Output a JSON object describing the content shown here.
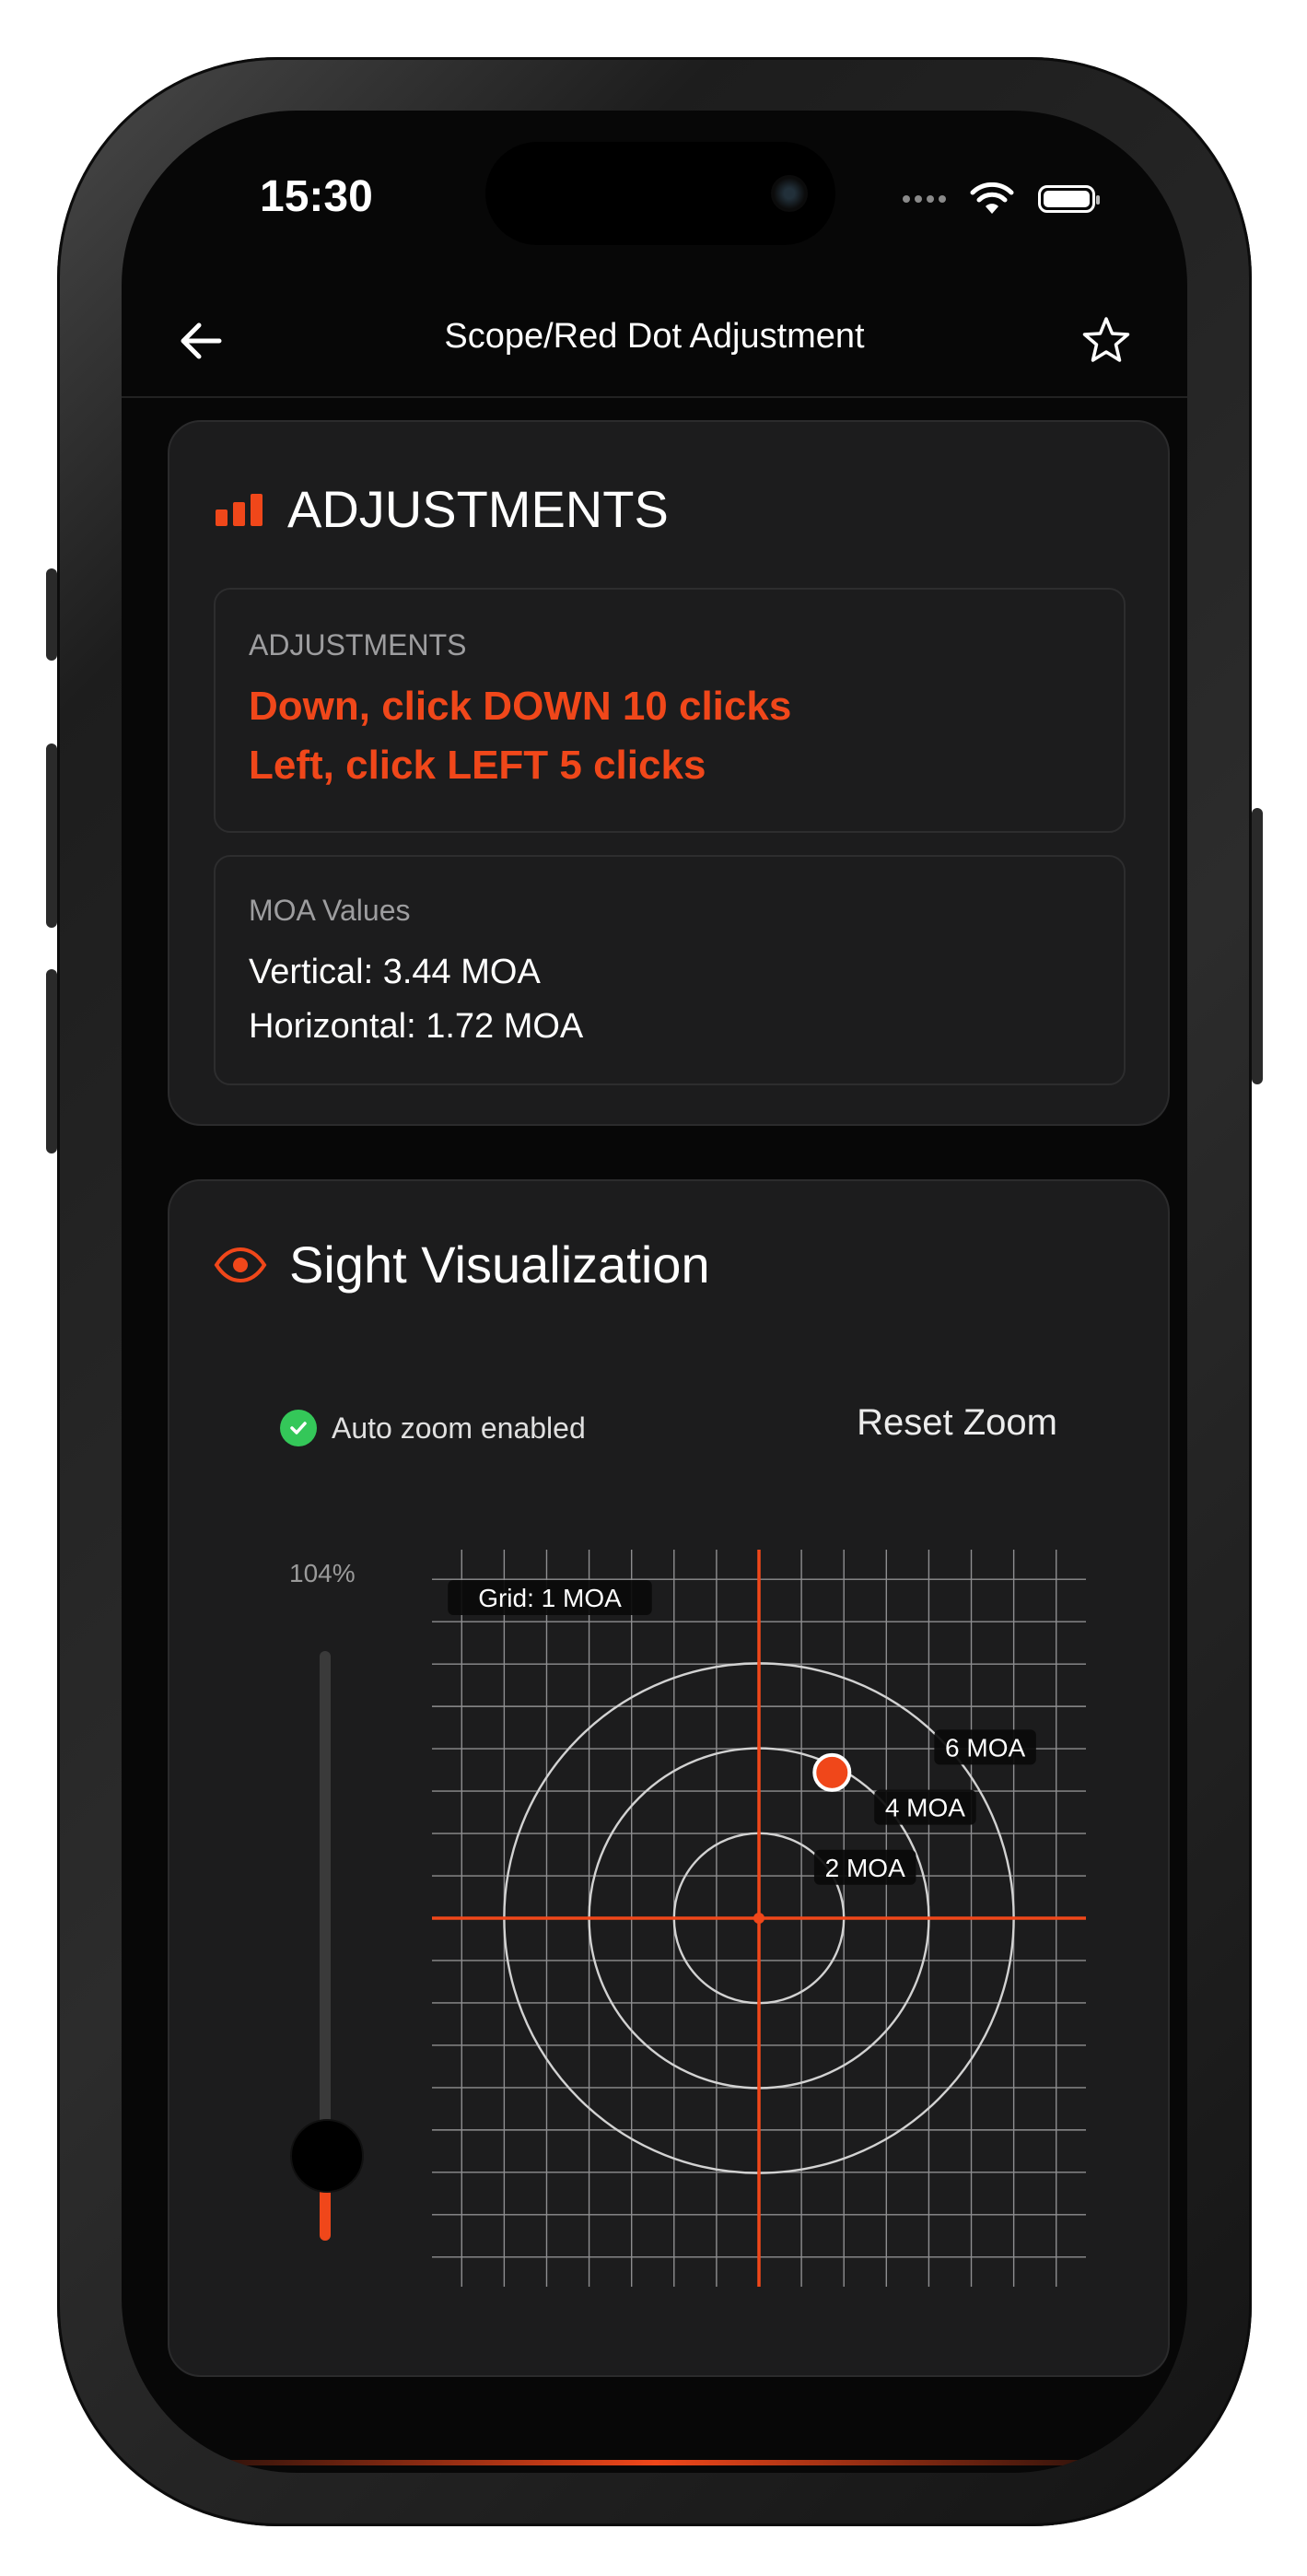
{
  "status": {
    "time": "15:30"
  },
  "nav": {
    "title": "Scope/Red Dot Adjustment",
    "back_icon": "arrow-left-icon",
    "favorite_icon": "star-icon"
  },
  "adjustments_card": {
    "icon": "bar-chart-icon",
    "title": "ADJUSTMENTS",
    "label": "ADJUSTMENTS",
    "lines": [
      "Down, click DOWN 10 clicks",
      "Left, click LEFT 5 clicks"
    ],
    "moa_label": "MOA Values",
    "moa_lines": [
      "Vertical: 3.44 MOA",
      "Horizontal: 1.72 MOA"
    ]
  },
  "sight_card": {
    "icon": "eye-icon",
    "title": "Sight Visualization",
    "auto_zoom_label": "Auto zoom enabled",
    "reset_zoom_label": "Reset Zoom",
    "zoom_percent_label": "104%",
    "zoom_slider_fraction": 0.1,
    "grid_label": "Grid: 1 MOA",
    "rings": [
      {
        "radius_moa": 2,
        "label": "2 MOA"
      },
      {
        "radius_moa": 4,
        "label": "4 MOA"
      },
      {
        "radius_moa": 6,
        "label": "6 MOA"
      }
    ],
    "impact_point": {
      "x_moa": 1.72,
      "y_moa": 3.44
    },
    "view_range_moa": {
      "x": [
        -7.7,
        7.7
      ],
      "y": [
        -8.7,
        8.7
      ]
    },
    "accent_color": "#f0471a"
  }
}
